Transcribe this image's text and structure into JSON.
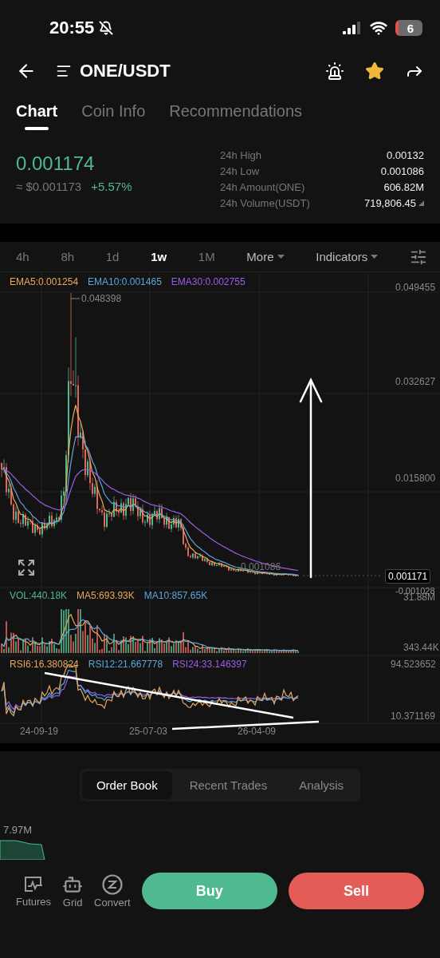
{
  "status_bar": {
    "time": "20:55",
    "battery": "6"
  },
  "header": {
    "title": "ONE/USDT",
    "favorited": true
  },
  "tabs": [
    {
      "label": "Chart",
      "selected": true
    },
    {
      "label": "Coin Info",
      "selected": false
    },
    {
      "label": "Recommendations",
      "selected": false
    }
  ],
  "ticker": {
    "price": "0.001174",
    "fiat": "≈ $0.001173",
    "change": "+5.57%"
  },
  "stats": [
    {
      "label": "24h High",
      "value": "0.00132"
    },
    {
      "label": "24h Low",
      "value": "0.001086"
    },
    {
      "label": "24h Amount(ONE)",
      "value": "606.82M"
    },
    {
      "label": "24h Volume(USDT)",
      "value": "719,806.45"
    }
  ],
  "intervals": [
    {
      "label": "4h",
      "selected": false
    },
    {
      "label": "8h",
      "selected": false
    },
    {
      "label": "1d",
      "selected": false
    },
    {
      "label": "1w",
      "selected": true
    },
    {
      "label": "1M",
      "selected": false
    }
  ],
  "dropdowns": [
    "More",
    "Indicators"
  ],
  "chart": {
    "ema_legend": [
      {
        "text": "EMA5:0.001254",
        "color": "#e9a85a"
      },
      {
        "text": "EMA10:0.001465",
        "color": "#5aa7dc"
      },
      {
        "text": "EMA30:0.002755",
        "color": "#9b5de5"
      }
    ],
    "price_axis": [
      "0.049455",
      "0.032627",
      "0.015800"
    ],
    "peak_label": "0.048398",
    "low_label": "0.001086",
    "last_price": "0.001171",
    "axis_min": "-0.001028",
    "volume_legend": [
      {
        "text": "VOL:440.18K",
        "color": "#4fb98f"
      },
      {
        "text": "MA5:693.93K",
        "color": "#e9a85a"
      },
      {
        "text": "MA10:857.65K",
        "color": "#5aa7dc"
      }
    ],
    "volume_axis": [
      "31.88M",
      "343.44K"
    ],
    "rsi_legend": [
      {
        "text": "RSI6:16.380824",
        "color": "#e9a85a"
      },
      {
        "text": "RSI12:21.667778",
        "color": "#5aa7dc"
      },
      {
        "text": "RSI24:33.146397",
        "color": "#9b5de5"
      }
    ],
    "rsi_axis": [
      "94.523652",
      "10.371169"
    ],
    "dates": [
      "24-09-19",
      "25-07-03",
      "26-04-09"
    ]
  },
  "book_tabs": [
    {
      "label": "Order Book",
      "selected": true
    },
    {
      "label": "Recent Trades",
      "selected": false
    },
    {
      "label": "Analysis",
      "selected": false
    }
  ],
  "depth_label": "7.97M",
  "tools": [
    "Futures",
    "Grid",
    "Convert"
  ],
  "actions": [
    {
      "label": "Buy",
      "kind": "buy"
    },
    {
      "label": "Sell",
      "kind": "sell"
    }
  ]
}
